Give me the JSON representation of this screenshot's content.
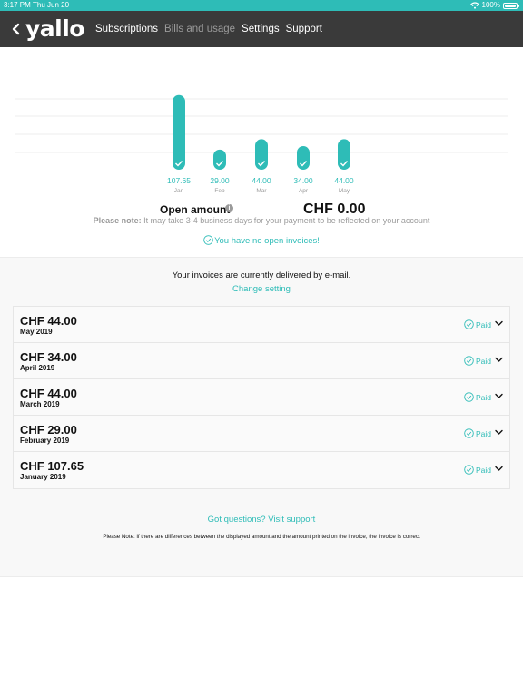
{
  "status_bar": {
    "time": "3:17 PM",
    "date": "Thu Jun 20",
    "battery": "100%"
  },
  "nav": {
    "logo": "yallo",
    "links": [
      {
        "label": "Subscriptions",
        "active": true
      },
      {
        "label": "Bills and usage",
        "active": false
      },
      {
        "label": "Settings",
        "active": true
      },
      {
        "label": "Support",
        "active": true
      }
    ]
  },
  "chart_data": {
    "type": "bar",
    "categories": [
      "Jan",
      "Feb",
      "Mar",
      "Apr",
      "May"
    ],
    "values": [
      107.65,
      29.0,
      44.0,
      34.0,
      44.0
    ],
    "labels": [
      "107.65",
      "29.00",
      "44.00",
      "34.00",
      "44.00"
    ],
    "ylim": [
      0,
      110
    ],
    "grid": true,
    "bar_color": "#2ebcb7",
    "title": "",
    "xlabel": "",
    "ylabel": ""
  },
  "summary": {
    "open_label": "Open amount",
    "open_value": "CHF 0.00",
    "note_prefix": "Please note:",
    "note_text": " It may take 3-4 business days for your payment to be reflected on your account",
    "no_open": "You have no open invoices!"
  },
  "delivery": {
    "text": "Your invoices are currently delivered by e-mail.",
    "change_link": "Change setting"
  },
  "invoices": [
    {
      "amount": "CHF 44.00",
      "month": "May 2019",
      "status": "Paid"
    },
    {
      "amount": "CHF 34.00",
      "month": "April 2019",
      "status": "Paid"
    },
    {
      "amount": "CHF 44.00",
      "month": "March 2019",
      "status": "Paid"
    },
    {
      "amount": "CHF 29.00",
      "month": "February 2019",
      "status": "Paid"
    },
    {
      "amount": "CHF 107.65",
      "month": "January 2019",
      "status": "Paid"
    }
  ],
  "footer": {
    "questions": "Got questions? Visit support",
    "disclaimer": "Please Note: if there are differences between the displayed amount and the amount printed on the invoice, the invoice is correct"
  },
  "colors": {
    "accent": "#2ebcb7",
    "nav_bg": "#3a3a3a",
    "muted": "#9a9a9a"
  }
}
